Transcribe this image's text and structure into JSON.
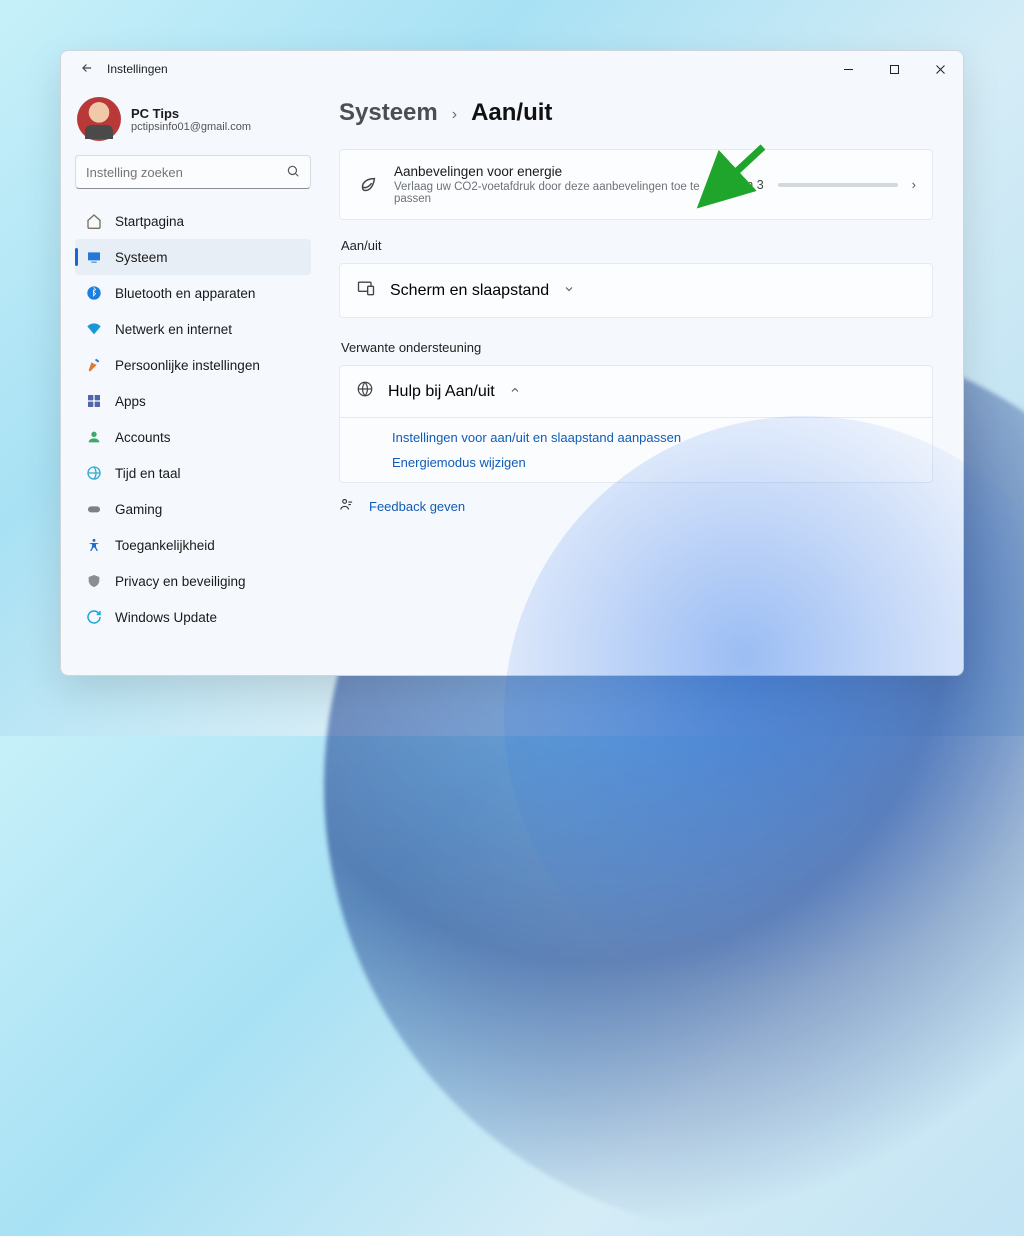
{
  "window": {
    "app_title": "Instellingen"
  },
  "profile": {
    "name": "PC Tips",
    "email": "pctipsinfo01@gmail.com"
  },
  "search": {
    "placeholder": "Instelling zoeken"
  },
  "sidebar": {
    "items": [
      {
        "label": "Startpagina"
      },
      {
        "label": "Systeem"
      },
      {
        "label": "Bluetooth en apparaten"
      },
      {
        "label": "Netwerk en internet"
      },
      {
        "label": "Persoonlijke instellingen"
      },
      {
        "label": "Apps"
      },
      {
        "label": "Accounts"
      },
      {
        "label": "Tijd en taal"
      },
      {
        "label": "Gaming"
      },
      {
        "label": "Toegankelijkheid"
      },
      {
        "label": "Privacy en beveiliging"
      },
      {
        "label": "Windows Update"
      }
    ]
  },
  "breadcrumb": {
    "root": "Systeem",
    "current": "Aan/uit"
  },
  "energy_card": {
    "title": "Aanbevelingen voor energie",
    "subtitle": "Verlaag uw CO2-voetafdruk door deze aanbevelingen toe te passen",
    "score": "0 van 3"
  },
  "sections": {
    "power_label": "Aan/uit",
    "screen_sleep": "Scherm en slaapstand",
    "related_label": "Verwante ondersteuning",
    "help_title": "Hulp bij Aan/uit",
    "help_links": [
      "Instellingen voor aan/uit en slaapstand aanpassen",
      "Energiemodus wijzigen"
    ],
    "feedback": "Feedback geven"
  }
}
